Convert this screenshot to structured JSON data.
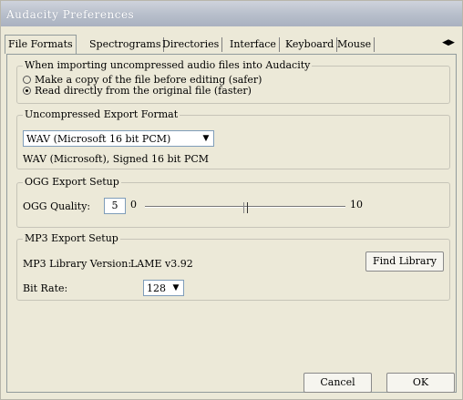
{
  "window": {
    "title": "Audacity Preferences"
  },
  "tabs": [
    {
      "label": "File Formats"
    },
    {
      "label": "Spectrograms"
    },
    {
      "label": "Directories"
    },
    {
      "label": "Interface"
    },
    {
      "label": "Keyboard"
    },
    {
      "label": "Mouse"
    }
  ],
  "tab_scroll": {
    "arrows": "◀▶"
  },
  "import_group": {
    "label": "When importing uncompressed audio files into Audacity",
    "options": [
      {
        "label": "Make a copy of the file before editing (safer)",
        "selected": false
      },
      {
        "label": "Read directly from the original file (faster)",
        "selected": true
      }
    ]
  },
  "export_group": {
    "label": "Uncompressed Export Format",
    "format_value": "WAV (Microsoft 16 bit PCM)",
    "format_description": "WAV (Microsoft), Signed 16 bit PCM"
  },
  "ogg_group": {
    "label": "OGG Export Setup",
    "quality_label": "OGG Quality:",
    "quality_value": "5",
    "slider_min": "0",
    "slider_max": "10"
  },
  "mp3_group": {
    "label": "MP3 Export Setup",
    "library_label": "MP3 Library Version:",
    "library_value": "LAME v3.92",
    "find_library_label": "Find Library",
    "bitrate_label": "Bit Rate:",
    "bitrate_value": "128"
  },
  "buttons": {
    "cancel": "Cancel",
    "ok": "OK"
  },
  "icons": {
    "dropdown_arrow": "▼"
  }
}
